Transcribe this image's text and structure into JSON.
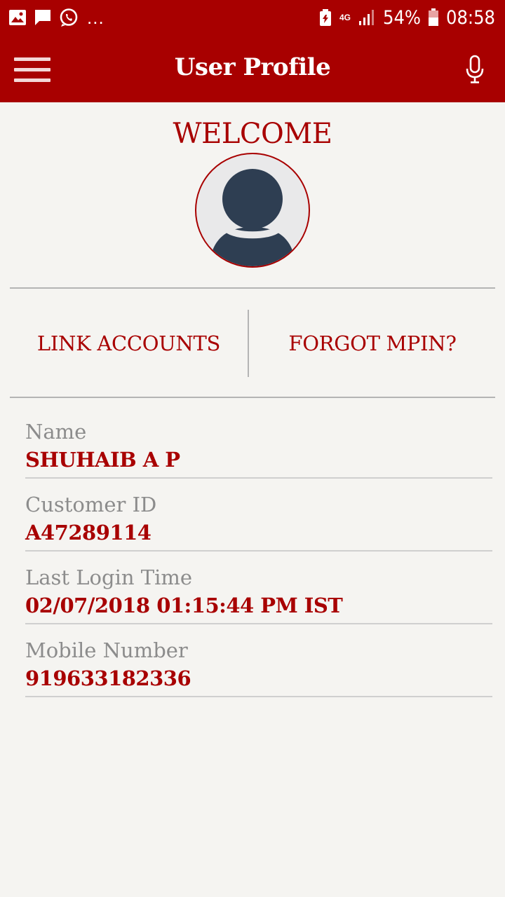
{
  "status_bar": {
    "battery_percent": "54%",
    "time": "08:58",
    "network": "4G",
    "notification_more": "...",
    "icons": [
      "gallery-icon",
      "message-icon",
      "whatsapp-icon",
      "battery-saver-icon",
      "signal-icon",
      "battery-icon"
    ]
  },
  "app_bar": {
    "title": "User Profile",
    "menu_icon": "hamburger-menu-icon",
    "voice_icon": "microphone-icon"
  },
  "profile": {
    "welcome": "WELCOME",
    "avatar_icon": "user-avatar-icon"
  },
  "actions": {
    "link_accounts": "LINK ACCOUNTS",
    "forgot_mpin": "FORGOT MPIN?"
  },
  "details": [
    {
      "label": "Name",
      "value": "SHUHAIB A P"
    },
    {
      "label": "Customer ID",
      "value": "A47289114"
    },
    {
      "label": "Last Login Time",
      "value": "02/07/2018 01:15:44 PM IST"
    },
    {
      "label": "Mobile Number",
      "value": "919633182336"
    }
  ],
  "colors": {
    "brand": "#a80000",
    "background": "#f5f4f1",
    "label": "#8c8c8c",
    "avatar_fill": "#2e3e52"
  }
}
